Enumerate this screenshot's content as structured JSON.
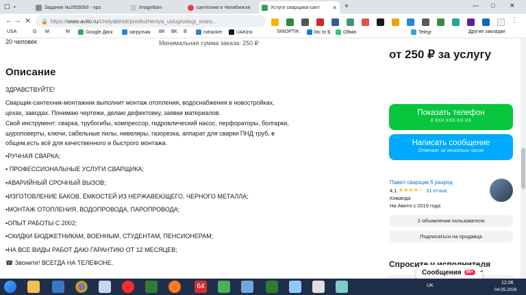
{
  "tabs": [
    {
      "label": "Задание №2959093 - про",
      "icon_color": "#8a8a8a"
    },
    {
      "label": "ImageBam",
      "icon_color": "#cccccc"
    },
    {
      "label": "сантехник в Челябинске",
      "icon_color": "#e2443b"
    },
    {
      "label": "Услуги сварщика-сант",
      "icon_color": "#ffffff"
    }
  ],
  "window_controls": {
    "minimize": "—",
    "maximize": "□",
    "close": "✕"
  },
  "address": {
    "prefix": "https://",
    "domain": "www.avito.ru",
    "path": "/chelyabinsk/predlozheniya_uslug/uslugi_svars..."
  },
  "bookmarks": [
    "USA",
    "G",
    "M",
    "M",
    "Google Диск",
    "загрузчик",
    "ВК",
    "ВК",
    "B",
    "rutracker",
    "UAKino",
    "SINOPTIK",
    "btc to $",
    "Обмін",
    "Telegr",
    "Другие закладки"
  ],
  "page": {
    "top_left": "20 человек",
    "min_order": "Минимальная сумма заказа: 250 ₽",
    "price": "от 250 ₽ за услугу",
    "desc_title": "Описание",
    "desc_lines": [
      "ЗДРАВСТВУЙТЕ!",
      "Сварщик-сантехник-монтажник выполнит монтаж отопления, водоснабжения в новостройках,",
      "цехах, заводах. Понимаю чертежи, делаю дефектовку, заявки материалов.",
      "Свой инструмент: сварка, трубогибы, компрессор, гидровлический насос, перфораторы, болгарки,",
      "шуроповерты, ключи, сабельные пилы, нивелиры, газорезка, аппарат для сварки ПНД труб, в",
      "общем,есть всё для качественного и быстрого монтажа.",
      "▪РУЧНАЯ СВАРКА;",
      "▪ ПРОФЕССИОНАЛЬНЫЕ УСЛУГИ СВАРЩИКА;",
      "▪АВАРИЙНЫЙ СРОЧНЫЙ ВЫЗОВ;",
      "▪ИЗГОТОВЛЕНИЕ БАКОВ, ЁМКОСТЕЙ ИЗ НЕРЖАВЕЮЩЕГО, ЧЕРНОГО МЕТАЛЛА;",
      "▪МОНТАЖ ОТОПЛЕНИЯ, ВОДОПРОВОДА, ПАРОПРОВОДА;",
      "▪ОПЫТ РАБОТЫ С 2002;",
      "▪СКИДКИ БЮДЖЕТНИКАМ, ВОЕННЫМ, СТУДЕНТАМ, ПЕНСИОНЕРАМ;",
      "▪НА ВСЕ ВИДЫ РАБОТ ДАЮ ГАРАНТИЮ ОТ 12 МЕСЯЦЕВ;",
      "☎ Звоните! ВСЕГДА НА ТЕЛЕФОНЕ."
    ],
    "show_phone": {
      "label": "Показать телефон",
      "sub": "8 XXX XXX-XX-XX"
    },
    "write_msg": {
      "label": "Написать сообщение",
      "sub": "Отвечает за несколько часов"
    },
    "seller": {
      "name": "Павел сварщик 6 разряд",
      "rating": "4,1",
      "stars": "★★★★☆",
      "reviews": "31 отзыв",
      "type": "Команда",
      "since": "На Авито с 2019 года"
    },
    "ads_btn": "2 объявления пользователя",
    "subscribe_btn": "Подписаться на продавца",
    "ask_heading": "Спросите у исполнителя"
  },
  "messages": {
    "label": "Сообщения",
    "badge": "99+"
  },
  "taskbar": {
    "lang": "UK",
    "time": "12:06",
    "date": "04.05.2026"
  },
  "colors": {
    "green": "#07c53d",
    "blue": "#00aaff",
    "link": "#0a74da"
  }
}
